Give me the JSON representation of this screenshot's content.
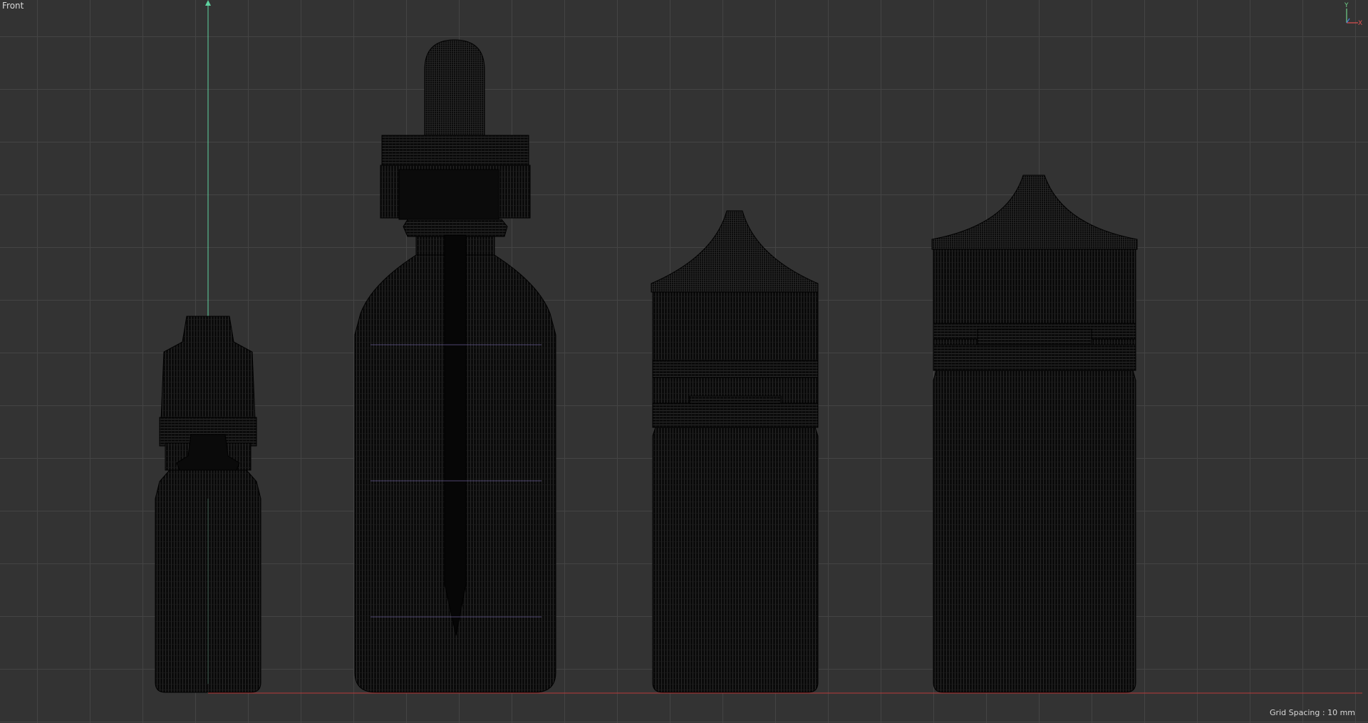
{
  "viewport": {
    "view_name": "Front",
    "grid_spacing": "Grid Spacing : 10 mm"
  },
  "axis_gizmo": {
    "y_label": "Y",
    "x_label": "X",
    "y_color": "#6fd08a",
    "x_color": "#e05050",
    "z_color": "#4a7bd8"
  },
  "colors": {
    "background": "#333333",
    "grid": "#444444",
    "wire": "#555555",
    "solid": "#0a0a0a",
    "origin_y_axis": "#5fd3a0",
    "origin_x_axis": "#b83a3a"
  },
  "objects": [
    {
      "name": "small-dropper-bottle"
    },
    {
      "name": "large-dropper-bottle"
    },
    {
      "name": "medium-chubby-gorilla-bottle"
    },
    {
      "name": "large-chubby-gorilla-bottle"
    }
  ]
}
